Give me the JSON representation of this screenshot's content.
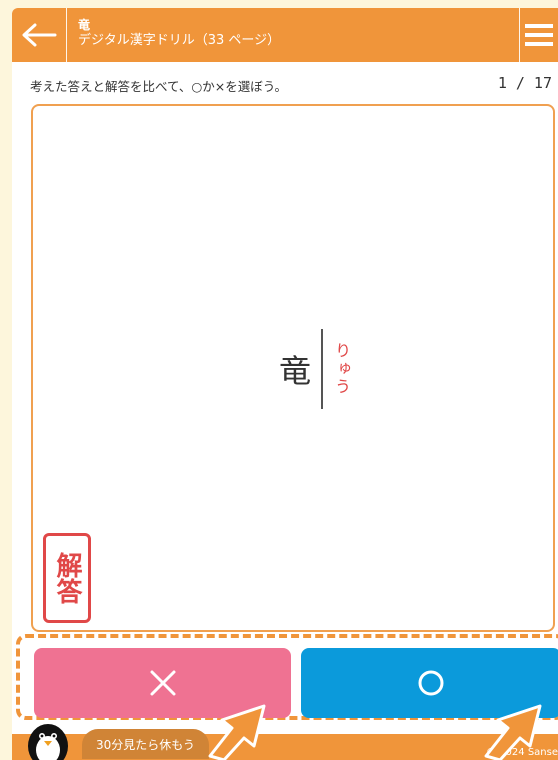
{
  "header": {
    "title": "竜",
    "subtitle": "デジタル漢字ドリル（33 ページ）"
  },
  "instruction": "考えた答えと解答を比べて、○か×を選ぼう。",
  "page_count": "1 / 17",
  "card": {
    "kanji": "竜",
    "reading": "りゅう",
    "stamp": "解答"
  },
  "buttons": {
    "wrong_symbol": "×",
    "correct_symbol": "○"
  },
  "footer": {
    "break_message": "30分見たら休もう",
    "copyright": "© 2024 Sanse"
  },
  "icons": {
    "back": "arrow-left-icon",
    "menu": "hamburger-menu-icon",
    "mascot": "penguin-icon",
    "pointer": "arrow-pointer-icon"
  },
  "colors": {
    "header": "#f0953a",
    "wrong": "#ef7292",
    "correct": "#0b9adb",
    "accent_red": "#e04848",
    "background": "#fdf6dc"
  }
}
